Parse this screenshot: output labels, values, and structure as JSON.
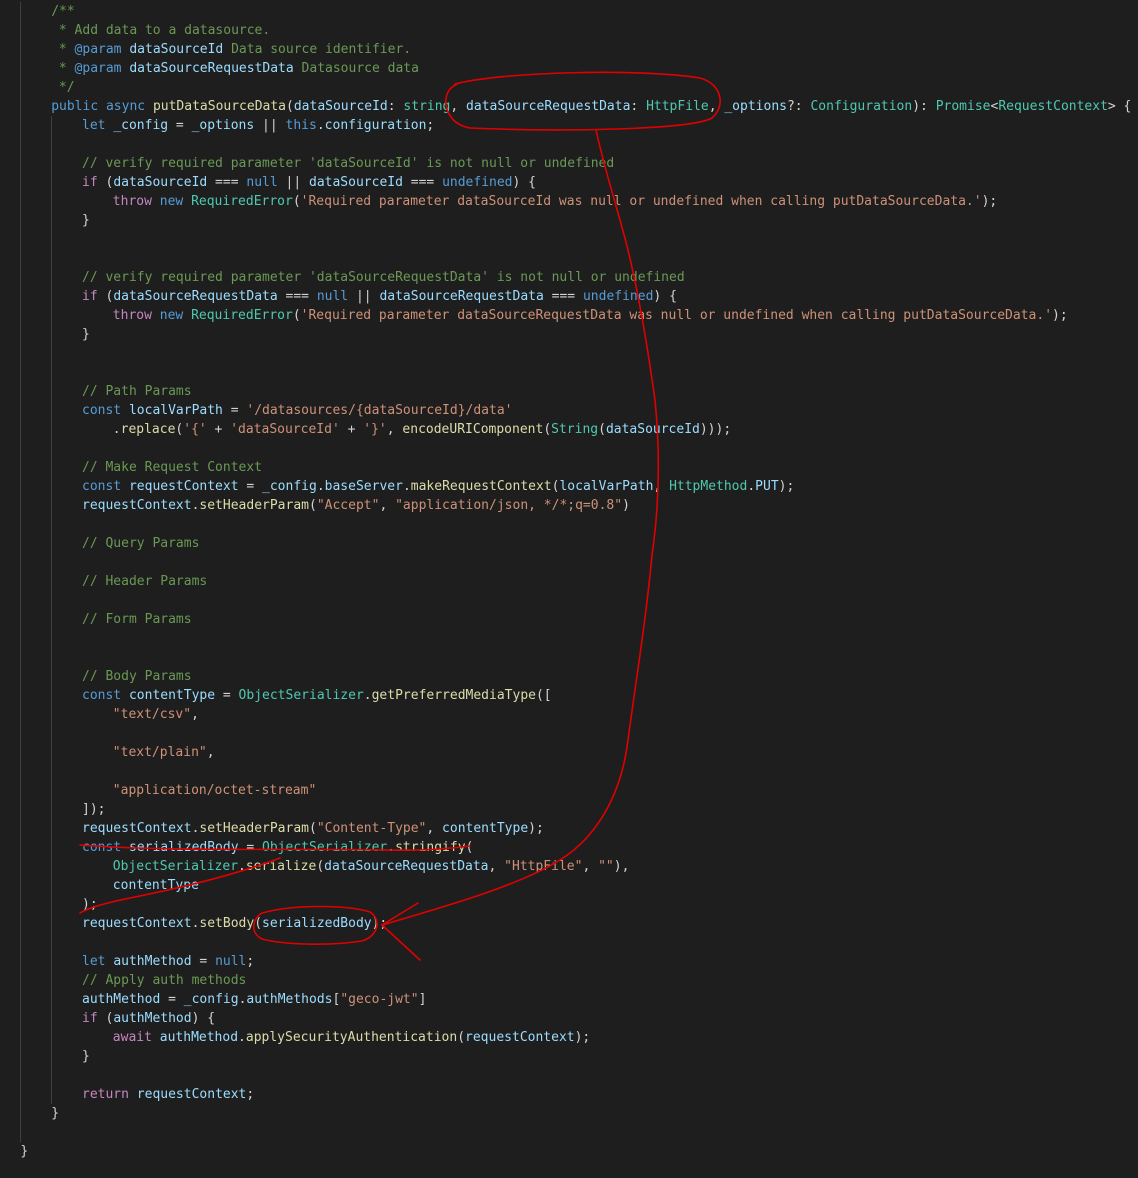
{
  "theme": {
    "background": "#1e1e1e",
    "colors": {
      "p": "#d4d4d4",
      "c": "#6a9955",
      "k": "#569cd6",
      "ck": "#c586c0",
      "f": "#dcdcaa",
      "v": "#9cdcfe",
      "t": "#4ec9b0",
      "s": "#ce9178",
      "n": "#b5cea8"
    },
    "annotation_color": "#e00000"
  },
  "editor": {
    "lines": [
      {
        "indent": 6,
        "tokens": [
          [
            "c",
            "/**"
          ]
        ]
      },
      {
        "indent": 7,
        "tokens": [
          [
            "c",
            "* Add data to a datasource."
          ]
        ]
      },
      {
        "indent": 7,
        "tokens": [
          [
            "c",
            "* "
          ],
          [
            "k",
            "@param"
          ],
          [
            "c",
            " "
          ],
          [
            "v",
            "dataSourceId"
          ],
          [
            "c",
            " Data source identifier."
          ]
        ]
      },
      {
        "indent": 7,
        "tokens": [
          [
            "c",
            "* "
          ],
          [
            "k",
            "@param"
          ],
          [
            "c",
            " "
          ],
          [
            "v",
            "dataSourceRequestData"
          ],
          [
            "c",
            " Datasource data"
          ]
        ]
      },
      {
        "indent": 7,
        "tokens": [
          [
            "c",
            "*/"
          ]
        ]
      },
      {
        "indent": 6,
        "tokens": [
          [
            "k",
            "public"
          ],
          [
            "p",
            " "
          ],
          [
            "k",
            "async"
          ],
          [
            "p",
            " "
          ],
          [
            "f",
            "putDataSourceData"
          ],
          [
            "p",
            "("
          ],
          [
            "v",
            "dataSourceId"
          ],
          [
            "p",
            ": "
          ],
          [
            "t",
            "string"
          ],
          [
            "p",
            ", "
          ],
          [
            "v",
            "dataSourceRequestData"
          ],
          [
            "p",
            ": "
          ],
          [
            "t",
            "HttpFile"
          ],
          [
            "p",
            ", "
          ],
          [
            "v",
            "_options"
          ],
          [
            "p",
            "?: "
          ],
          [
            "t",
            "Configuration"
          ],
          [
            "p",
            "): "
          ],
          [
            "t",
            "Promise"
          ],
          [
            "p",
            "<"
          ],
          [
            "t",
            "RequestContext"
          ],
          [
            "p",
            "> {"
          ]
        ]
      },
      {
        "indent": 10,
        "tokens": [
          [
            "k",
            "let"
          ],
          [
            "p",
            " "
          ],
          [
            "v",
            "_config"
          ],
          [
            "p",
            " = "
          ],
          [
            "v",
            "_options"
          ],
          [
            "p",
            " || "
          ],
          [
            "k",
            "this"
          ],
          [
            "p",
            "."
          ],
          [
            "v",
            "configuration"
          ],
          [
            "p",
            ";"
          ]
        ]
      },
      {
        "indent": 0,
        "tokens": []
      },
      {
        "indent": 10,
        "tokens": [
          [
            "c",
            "// verify required parameter 'dataSourceId' is not null or undefined"
          ]
        ]
      },
      {
        "indent": 10,
        "tokens": [
          [
            "ck",
            "if"
          ],
          [
            "p",
            " ("
          ],
          [
            "v",
            "dataSourceId"
          ],
          [
            "p",
            " === "
          ],
          [
            "k",
            "null"
          ],
          [
            "p",
            " || "
          ],
          [
            "v",
            "dataSourceId"
          ],
          [
            "p",
            " === "
          ],
          [
            "k",
            "undefined"
          ],
          [
            "p",
            ") {"
          ]
        ]
      },
      {
        "indent": 14,
        "tokens": [
          [
            "ck",
            "throw"
          ],
          [
            "p",
            " "
          ],
          [
            "k",
            "new"
          ],
          [
            "p",
            " "
          ],
          [
            "t",
            "RequiredError"
          ],
          [
            "p",
            "("
          ],
          [
            "s",
            "'Required parameter dataSourceId was null or undefined when calling putDataSourceData.'"
          ],
          [
            "p",
            ");"
          ]
        ]
      },
      {
        "indent": 10,
        "tokens": [
          [
            "p",
            "}"
          ]
        ]
      },
      {
        "indent": 0,
        "tokens": []
      },
      {
        "indent": 0,
        "tokens": []
      },
      {
        "indent": 10,
        "tokens": [
          [
            "c",
            "// verify required parameter 'dataSourceRequestData' is not null or undefined"
          ]
        ]
      },
      {
        "indent": 10,
        "tokens": [
          [
            "ck",
            "if"
          ],
          [
            "p",
            " ("
          ],
          [
            "v",
            "dataSourceRequestData"
          ],
          [
            "p",
            " === "
          ],
          [
            "k",
            "null"
          ],
          [
            "p",
            " || "
          ],
          [
            "v",
            "dataSourceRequestData"
          ],
          [
            "p",
            " === "
          ],
          [
            "k",
            "undefined"
          ],
          [
            "p",
            ") {"
          ]
        ]
      },
      {
        "indent": 14,
        "tokens": [
          [
            "ck",
            "throw"
          ],
          [
            "p",
            " "
          ],
          [
            "k",
            "new"
          ],
          [
            "p",
            " "
          ],
          [
            "t",
            "RequiredError"
          ],
          [
            "p",
            "("
          ],
          [
            "s",
            "'Required parameter dataSourceRequestData was null or undefined when calling putDataSourceData.'"
          ],
          [
            "p",
            ");"
          ]
        ]
      },
      {
        "indent": 10,
        "tokens": [
          [
            "p",
            "}"
          ]
        ]
      },
      {
        "indent": 0,
        "tokens": []
      },
      {
        "indent": 0,
        "tokens": []
      },
      {
        "indent": 10,
        "tokens": [
          [
            "c",
            "// Path Params"
          ]
        ]
      },
      {
        "indent": 10,
        "tokens": [
          [
            "k",
            "const"
          ],
          [
            "p",
            " "
          ],
          [
            "v",
            "localVarPath"
          ],
          [
            "p",
            " = "
          ],
          [
            "s",
            "'/datasources/{dataSourceId}/data'"
          ]
        ]
      },
      {
        "indent": 14,
        "tokens": [
          [
            "p",
            "."
          ],
          [
            "f",
            "replace"
          ],
          [
            "p",
            "("
          ],
          [
            "s",
            "'{'"
          ],
          [
            "p",
            " + "
          ],
          [
            "s",
            "'dataSourceId'"
          ],
          [
            "p",
            " + "
          ],
          [
            "s",
            "'}'"
          ],
          [
            "p",
            ", "
          ],
          [
            "f",
            "encodeURIComponent"
          ],
          [
            "p",
            "("
          ],
          [
            "t",
            "String"
          ],
          [
            "p",
            "("
          ],
          [
            "v",
            "dataSourceId"
          ],
          [
            "p",
            ")));"
          ]
        ]
      },
      {
        "indent": 0,
        "tokens": []
      },
      {
        "indent": 10,
        "tokens": [
          [
            "c",
            "// Make Request Context"
          ]
        ]
      },
      {
        "indent": 10,
        "tokens": [
          [
            "k",
            "const"
          ],
          [
            "p",
            " "
          ],
          [
            "v",
            "requestContext"
          ],
          [
            "p",
            " = "
          ],
          [
            "v",
            "_config"
          ],
          [
            "p",
            "."
          ],
          [
            "v",
            "baseServer"
          ],
          [
            "p",
            "."
          ],
          [
            "f",
            "makeRequestContext"
          ],
          [
            "p",
            "("
          ],
          [
            "v",
            "localVarPath"
          ],
          [
            "p",
            ", "
          ],
          [
            "t",
            "HttpMethod"
          ],
          [
            "p",
            "."
          ],
          [
            "v",
            "PUT"
          ],
          [
            "p",
            ");"
          ]
        ]
      },
      {
        "indent": 10,
        "tokens": [
          [
            "v",
            "requestContext"
          ],
          [
            "p",
            "."
          ],
          [
            "f",
            "setHeaderParam"
          ],
          [
            "p",
            "("
          ],
          [
            "s",
            "\"Accept\""
          ],
          [
            "p",
            ", "
          ],
          [
            "s",
            "\"application/json, */*;q=0.8\""
          ],
          [
            "p",
            ")"
          ]
        ]
      },
      {
        "indent": 0,
        "tokens": []
      },
      {
        "indent": 10,
        "tokens": [
          [
            "c",
            "// Query Params"
          ]
        ]
      },
      {
        "indent": 0,
        "tokens": []
      },
      {
        "indent": 10,
        "tokens": [
          [
            "c",
            "// Header Params"
          ]
        ]
      },
      {
        "indent": 0,
        "tokens": []
      },
      {
        "indent": 10,
        "tokens": [
          [
            "c",
            "// Form Params"
          ]
        ]
      },
      {
        "indent": 0,
        "tokens": []
      },
      {
        "indent": 0,
        "tokens": []
      },
      {
        "indent": 10,
        "tokens": [
          [
            "c",
            "// Body Params"
          ]
        ]
      },
      {
        "indent": 10,
        "tokens": [
          [
            "k",
            "const"
          ],
          [
            "p",
            " "
          ],
          [
            "v",
            "contentType"
          ],
          [
            "p",
            " = "
          ],
          [
            "t",
            "ObjectSerializer"
          ],
          [
            "p",
            "."
          ],
          [
            "f",
            "getPreferredMediaType"
          ],
          [
            "p",
            "(["
          ]
        ]
      },
      {
        "indent": 14,
        "tokens": [
          [
            "s",
            "\"text/csv\""
          ],
          [
            "p",
            ","
          ]
        ]
      },
      {
        "indent": 0,
        "tokens": []
      },
      {
        "indent": 14,
        "tokens": [
          [
            "s",
            "\"text/plain\""
          ],
          [
            "p",
            ","
          ]
        ]
      },
      {
        "indent": 0,
        "tokens": []
      },
      {
        "indent": 14,
        "tokens": [
          [
            "s",
            "\"application/octet-stream\""
          ]
        ]
      },
      {
        "indent": 10,
        "tokens": [
          [
            "p",
            "]);"
          ]
        ]
      },
      {
        "indent": 10,
        "tokens": [
          [
            "v",
            "requestContext"
          ],
          [
            "p",
            "."
          ],
          [
            "f",
            "setHeaderParam"
          ],
          [
            "p",
            "("
          ],
          [
            "s",
            "\"Content-Type\""
          ],
          [
            "p",
            ", "
          ],
          [
            "v",
            "contentType"
          ],
          [
            "p",
            ");"
          ]
        ]
      },
      {
        "indent": 10,
        "tokens": [
          [
            "k",
            "const"
          ],
          [
            "p",
            " "
          ],
          [
            "v",
            "serializedBody"
          ],
          [
            "p",
            " = "
          ],
          [
            "t",
            "ObjectSerializer"
          ],
          [
            "p",
            "."
          ],
          [
            "f",
            "stringify"
          ],
          [
            "p",
            "("
          ]
        ]
      },
      {
        "indent": 14,
        "tokens": [
          [
            "t",
            "ObjectSerializer"
          ],
          [
            "p",
            "."
          ],
          [
            "f",
            "serialize"
          ],
          [
            "p",
            "("
          ],
          [
            "v",
            "dataSourceRequestData"
          ],
          [
            "p",
            ", "
          ],
          [
            "s",
            "\"HttpFile\""
          ],
          [
            "p",
            ", "
          ],
          [
            "s",
            "\"\""
          ],
          [
            "p",
            "),"
          ]
        ]
      },
      {
        "indent": 14,
        "tokens": [
          [
            "v",
            "contentType"
          ]
        ]
      },
      {
        "indent": 10,
        "tokens": [
          [
            "p",
            ");"
          ]
        ]
      },
      {
        "indent": 10,
        "tokens": [
          [
            "v",
            "requestContext"
          ],
          [
            "p",
            "."
          ],
          [
            "f",
            "setBody"
          ],
          [
            "p",
            "("
          ],
          [
            "v",
            "serializedBody"
          ],
          [
            "p",
            ");"
          ]
        ]
      },
      {
        "indent": 0,
        "tokens": []
      },
      {
        "indent": 10,
        "tokens": [
          [
            "k",
            "let"
          ],
          [
            "p",
            " "
          ],
          [
            "v",
            "authMethod"
          ],
          [
            "p",
            " = "
          ],
          [
            "k",
            "null"
          ],
          [
            "p",
            ";"
          ]
        ]
      },
      {
        "indent": 10,
        "tokens": [
          [
            "c",
            "// Apply auth methods"
          ]
        ]
      },
      {
        "indent": 10,
        "tokens": [
          [
            "v",
            "authMethod"
          ],
          [
            "p",
            " = "
          ],
          [
            "v",
            "_config"
          ],
          [
            "p",
            "."
          ],
          [
            "v",
            "authMethods"
          ],
          [
            "p",
            "["
          ],
          [
            "s",
            "\"geco-jwt\""
          ],
          [
            "p",
            "]"
          ]
        ]
      },
      {
        "indent": 10,
        "tokens": [
          [
            "ck",
            "if"
          ],
          [
            "p",
            " ("
          ],
          [
            "v",
            "authMethod"
          ],
          [
            "p",
            ") {"
          ]
        ]
      },
      {
        "indent": 14,
        "tokens": [
          [
            "ck",
            "await"
          ],
          [
            "p",
            " "
          ],
          [
            "v",
            "authMethod"
          ],
          [
            "p",
            "."
          ],
          [
            "f",
            "applySecurityAuthentication"
          ],
          [
            "p",
            "("
          ],
          [
            "v",
            "requestContext"
          ],
          [
            "p",
            ");"
          ]
        ]
      },
      {
        "indent": 10,
        "tokens": [
          [
            "p",
            "}"
          ]
        ]
      },
      {
        "indent": 0,
        "tokens": []
      },
      {
        "indent": 10,
        "tokens": [
          [
            "ck",
            "return"
          ],
          [
            "p",
            " "
          ],
          [
            "v",
            "requestContext"
          ],
          [
            "p",
            ";"
          ]
        ]
      },
      {
        "indent": 6,
        "tokens": [
          [
            "p",
            "}"
          ]
        ]
      },
      {
        "indent": 0,
        "tokens": []
      },
      {
        "indent": 2,
        "tokens": [
          [
            "p",
            "}"
          ]
        ]
      }
    ]
  }
}
